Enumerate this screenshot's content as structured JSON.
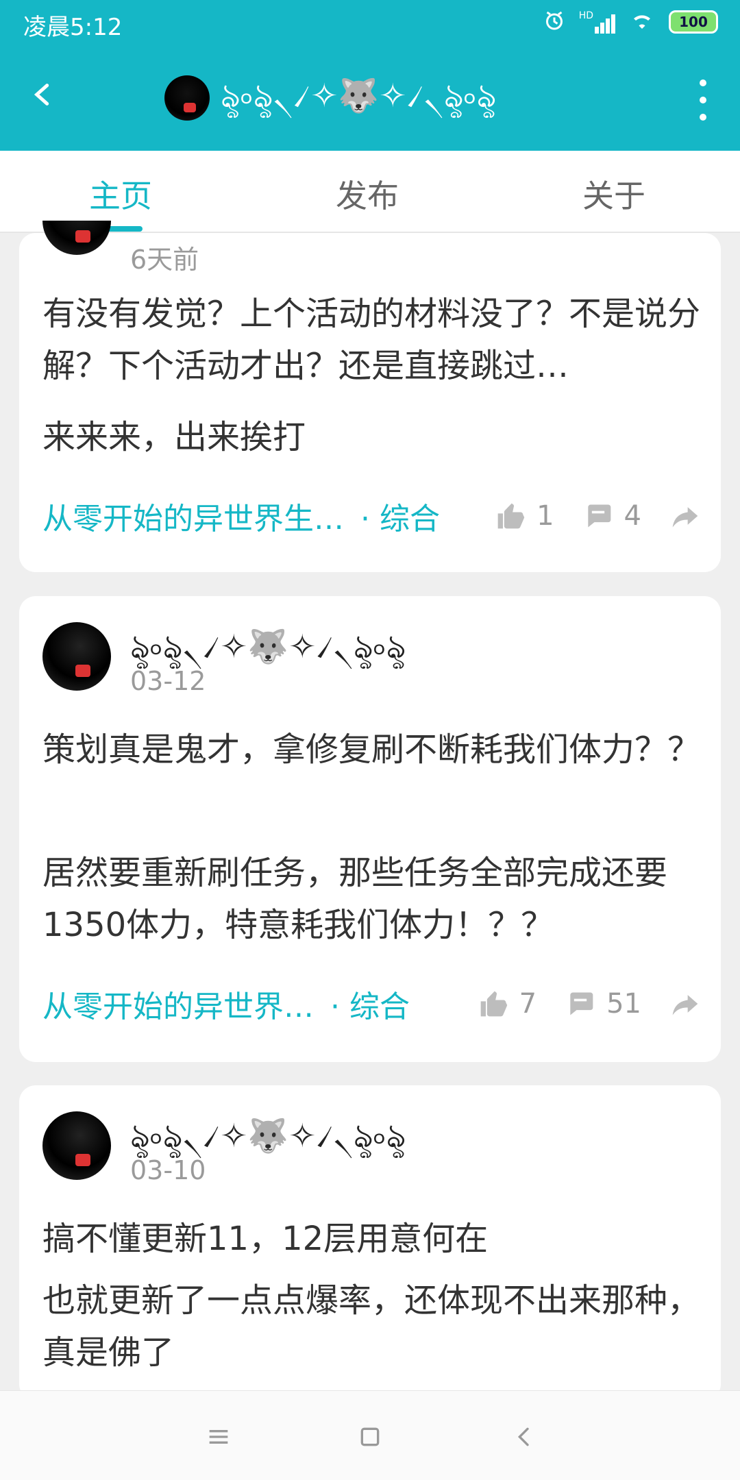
{
  "status_bar": {
    "time": "凌晨5:12",
    "hd_label": "HD",
    "battery": "100"
  },
  "toolbar": {
    "user_name": "ৡ৹ৡ৲৴✧🐺✧৴৲ৡ৹ৡ"
  },
  "tabs": [
    {
      "label": "主页"
    },
    {
      "label": "发布"
    },
    {
      "label": "关于"
    }
  ],
  "posts": [
    {
      "date": "6天前",
      "title": "有没有发觉？上个活动的材料没了？不是说分解？下个活动才出？还是直接跳过…",
      "body": "来来来，出来挨打",
      "topic": "从零开始的异世界生…",
      "category": "· 综合",
      "likes": "1",
      "comments": "4"
    },
    {
      "name": "ৡ৹ৡ৲৴✧🐺✧৴৲ৡ৹ৡ",
      "date": "03-12",
      "title": "策划真是鬼才，拿修复刷不断耗我们体力？？",
      "body": "居然要重新刷任务，那些任务全部完成还要1350体力，特意耗我们体力！？？",
      "topic": "从零开始的异世界…",
      "category": "· 综合",
      "likes": "7",
      "comments": "51"
    },
    {
      "name": "ৡ৹ৡ৲৴✧🐺✧৴৲ৡ৹ৡ",
      "date": "03-10",
      "title": "搞不懂更新11，12层用意何在",
      "body": "也就更新了一点点爆率，还体现不出来那种，真是佛了"
    }
  ],
  "colors": {
    "accent": "#15b7c6",
    "background": "#efefef",
    "card": "#ffffff"
  },
  "icons": {
    "like": "thumb-up-icon",
    "comment": "comment-icon",
    "share": "share-icon",
    "back": "back-arrow-icon",
    "more": "more-vert-icon"
  }
}
